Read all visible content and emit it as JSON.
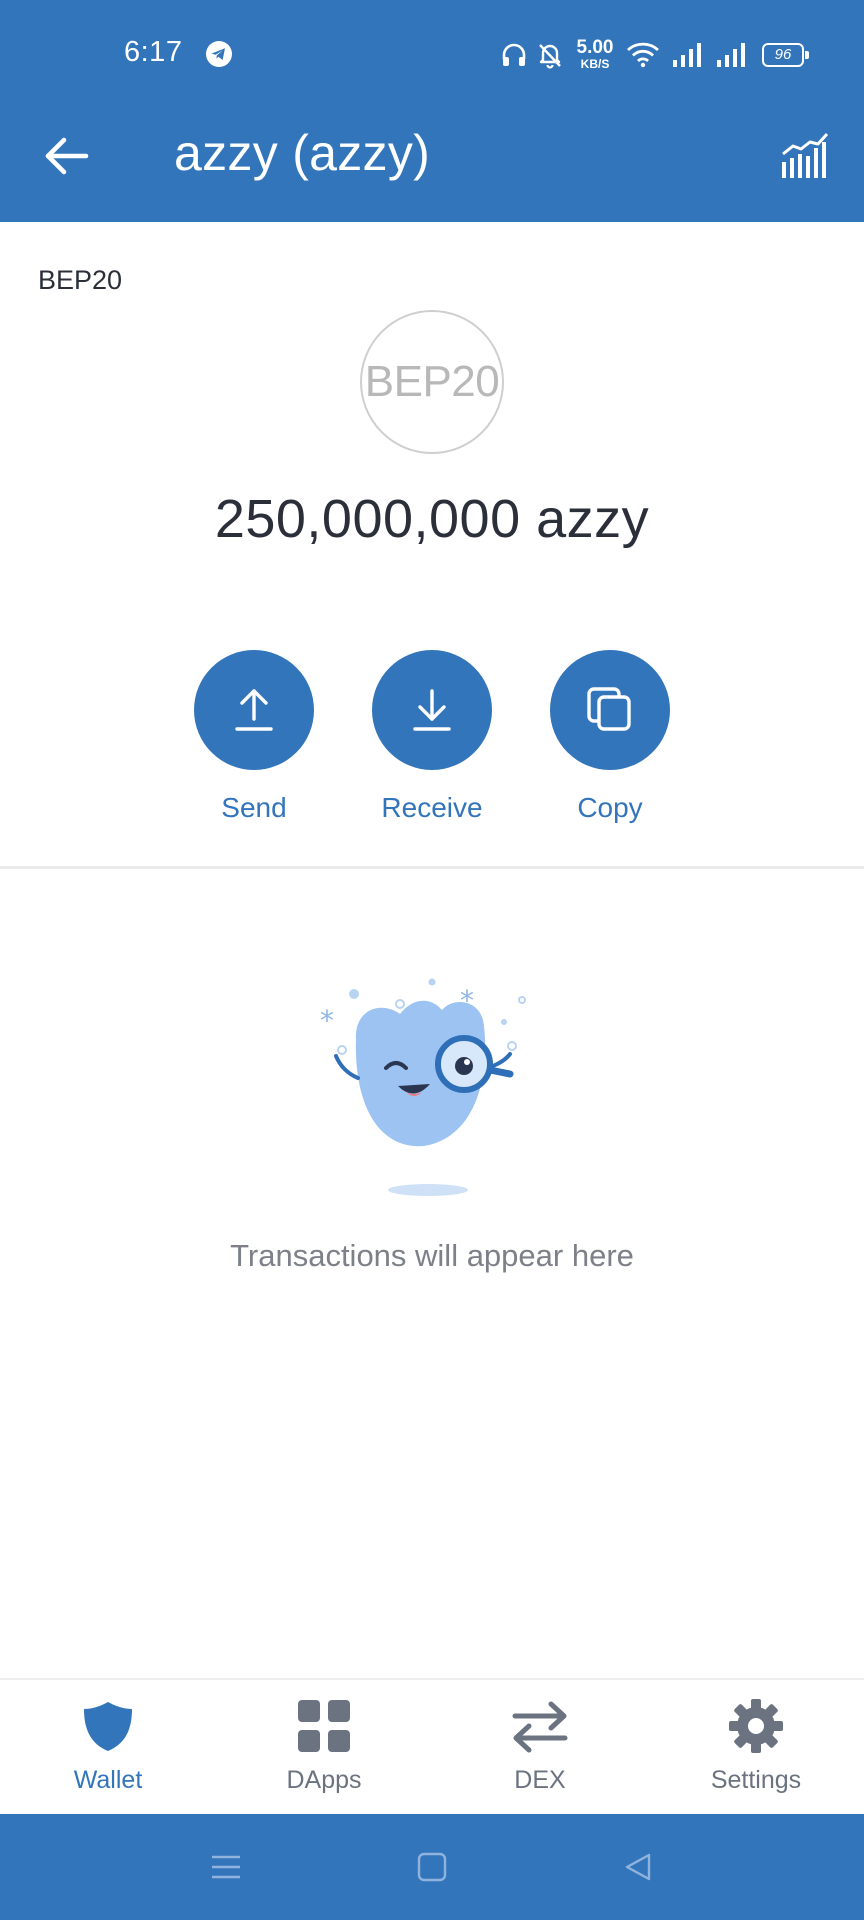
{
  "status_bar": {
    "time": "6:17",
    "net_speed_value": "5.00",
    "net_speed_unit": "KB/S",
    "battery": "96",
    "icons": [
      "telegram-icon",
      "headphones-icon",
      "bell-off-icon",
      "wifi-icon",
      "signal-icon",
      "signal-icon",
      "battery-icon"
    ]
  },
  "header": {
    "title": "azzy (azzy)",
    "back_icon": "arrow-left-icon",
    "chart_icon": "chart-icon"
  },
  "token": {
    "network": "BEP20",
    "logo_text": "BEP20",
    "balance": "250,000,000 azzy"
  },
  "actions": [
    {
      "label": "Send",
      "icon": "upload-icon"
    },
    {
      "label": "Receive",
      "icon": "download-icon"
    },
    {
      "label": "Copy",
      "icon": "copy-icon"
    }
  ],
  "empty_state": {
    "message": "Transactions will appear here",
    "illustration": "mascot-magnifier-illustration"
  },
  "bottom_nav": [
    {
      "label": "Wallet",
      "icon": "shield-icon",
      "active": true
    },
    {
      "label": "DApps",
      "icon": "grid-icon",
      "active": false
    },
    {
      "label": "DEX",
      "icon": "swap-icon",
      "active": false
    },
    {
      "label": "Settings",
      "icon": "gear-icon",
      "active": false
    }
  ],
  "colors": {
    "brand": "#3375bb",
    "text_primary": "#2b2f3a",
    "text_muted": "#7d8089",
    "nav_inactive": "#6b7380"
  }
}
